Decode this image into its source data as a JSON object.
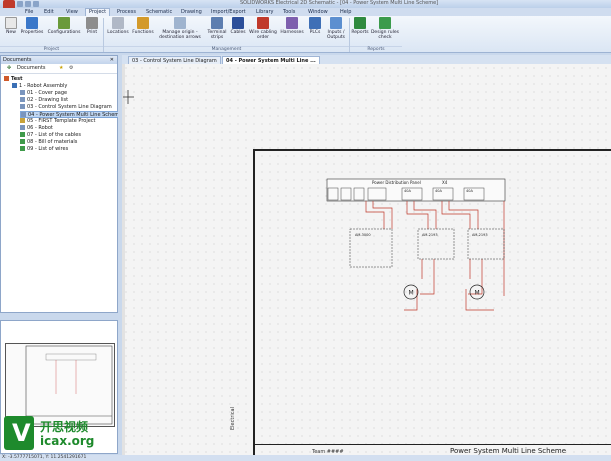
{
  "window": {
    "title": "SOLIDWORKS Electrical 2D Schematic - [04 - Power System Multi Line Scheme]"
  },
  "menu_tabs": [
    "File",
    "Edit",
    "View",
    "Project",
    "Process",
    "Schematic",
    "Drawing",
    "Import/Export",
    "Library",
    "Tools",
    "Window",
    "Help"
  ],
  "active_tab": "Project",
  "ribbon": {
    "buttons": [
      {
        "label": "New",
        "icon": "new-project-icon"
      },
      {
        "label": "Properties",
        "icon": "properties-icon"
      },
      {
        "label": "Configurations",
        "icon": "configurations-icon"
      },
      {
        "label": "Print",
        "icon": "print-icon"
      },
      {
        "label": "Locations",
        "icon": "locations-icon"
      },
      {
        "label": "Functions",
        "icon": "functions-icon"
      },
      {
        "label": "Manage origin - destination arrows",
        "icon": "arrows-icon"
      },
      {
        "label": "Terminal strips",
        "icon": "terminal-strips-icon"
      },
      {
        "label": "Cables",
        "icon": "cables-icon"
      },
      {
        "label": "Wire cabling order",
        "icon": "wire-cabling-icon"
      },
      {
        "label": "Harnesses",
        "icon": "harnesses-icon"
      },
      {
        "label": "PLCs",
        "icon": "plc-icon"
      },
      {
        "label": "Inputs / Outputs",
        "icon": "io-icon"
      },
      {
        "label": "Reports",
        "icon": "reports-icon"
      },
      {
        "label": "Design rules check",
        "icon": "design-rules-icon"
      }
    ],
    "groups": [
      "Project",
      "Management",
      "Reports"
    ]
  },
  "documents_panel": {
    "title": "Documents",
    "toolbar_label": "Documents",
    "tree": [
      {
        "label": "Test",
        "level": 0,
        "selected": false
      },
      {
        "label": "1 - Robot Assembly",
        "level": 1,
        "selected": false
      },
      {
        "label": "01 - Cover page",
        "level": 2,
        "selected": false
      },
      {
        "label": "02 - Drawing list",
        "level": 2,
        "selected": false
      },
      {
        "label": "03 - Control System Line Diagram",
        "level": 2,
        "selected": false
      },
      {
        "label": "04 - Power System Multi Line Scheme",
        "level": 2,
        "selected": true
      },
      {
        "label": "05 - FIRST Template Project",
        "level": 2,
        "selected": false
      },
      {
        "label": "06 - Robot",
        "level": 2,
        "selected": false
      },
      {
        "label": "07 - List of the cables",
        "level": 2,
        "selected": false
      },
      {
        "label": "08 - Bill of materials",
        "level": 2,
        "selected": false
      },
      {
        "label": "09 - List of wires",
        "level": 2,
        "selected": false
      }
    ]
  },
  "doc_tabs": [
    {
      "label": "03 - Control System Line Diagram",
      "active": false
    },
    {
      "label": "04 - Power System Multi Line ...",
      "active": true
    }
  ],
  "schematic": {
    "panel_title": "Power Distribution Panel",
    "panel_tag": "X4",
    "terminal_labels": [
      "40A",
      "40A",
      "40A"
    ],
    "device_labels": [
      "AM-3000",
      "AM-2193",
      "AM-2193"
    ],
    "motor_label": "M",
    "sheet_title": "Power System Multi Line Scheme",
    "team_label": "Team ####",
    "side_label": "Electrical"
  },
  "status_bar": {
    "text": "X: -3.5777715071, Y: 11.2541291671"
  },
  "watermark": {
    "cn": "开思视频",
    "url": "icax.org"
  }
}
